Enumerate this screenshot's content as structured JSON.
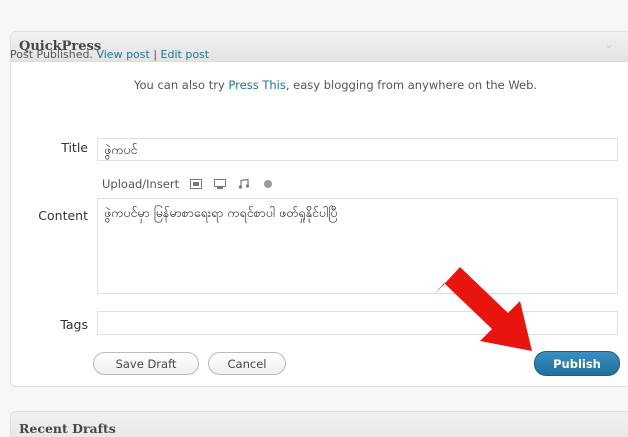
{
  "quickpress": {
    "title": "QuickPress",
    "collapse_glyph": "⌄",
    "notice": {
      "prefix": "Post Published.",
      "view_link": "View post",
      "separator": "|",
      "edit_link": "Edit post"
    },
    "press_this": {
      "prefix": "You can also try",
      "link": "Press This",
      "suffix": ", easy blogging from anywhere on the Web."
    },
    "form": {
      "title_label": "Title",
      "title_value": "ဖွဲကပင်",
      "upload_insert_label": "Upload/Insert",
      "media_icons": [
        "image-icon",
        "video-icon",
        "audio-icon",
        "media-icon"
      ],
      "content_label": "Content",
      "content_value": "ဖွဲကပင်မှာ မြန်မာစာရေးရာ ကရင်စာပါ ဖတ်ရှုနိုင်ပါပြီ",
      "tags_label": "Tags",
      "tags_value": ""
    },
    "buttons": {
      "save_draft": "Save Draft",
      "cancel": "Cancel",
      "publish": "Publish"
    }
  },
  "recent_drafts": {
    "title": "Recent Drafts"
  },
  "colors": {
    "link": "#21759b",
    "publish": "#216f9c",
    "arrow": "#e8140e"
  }
}
